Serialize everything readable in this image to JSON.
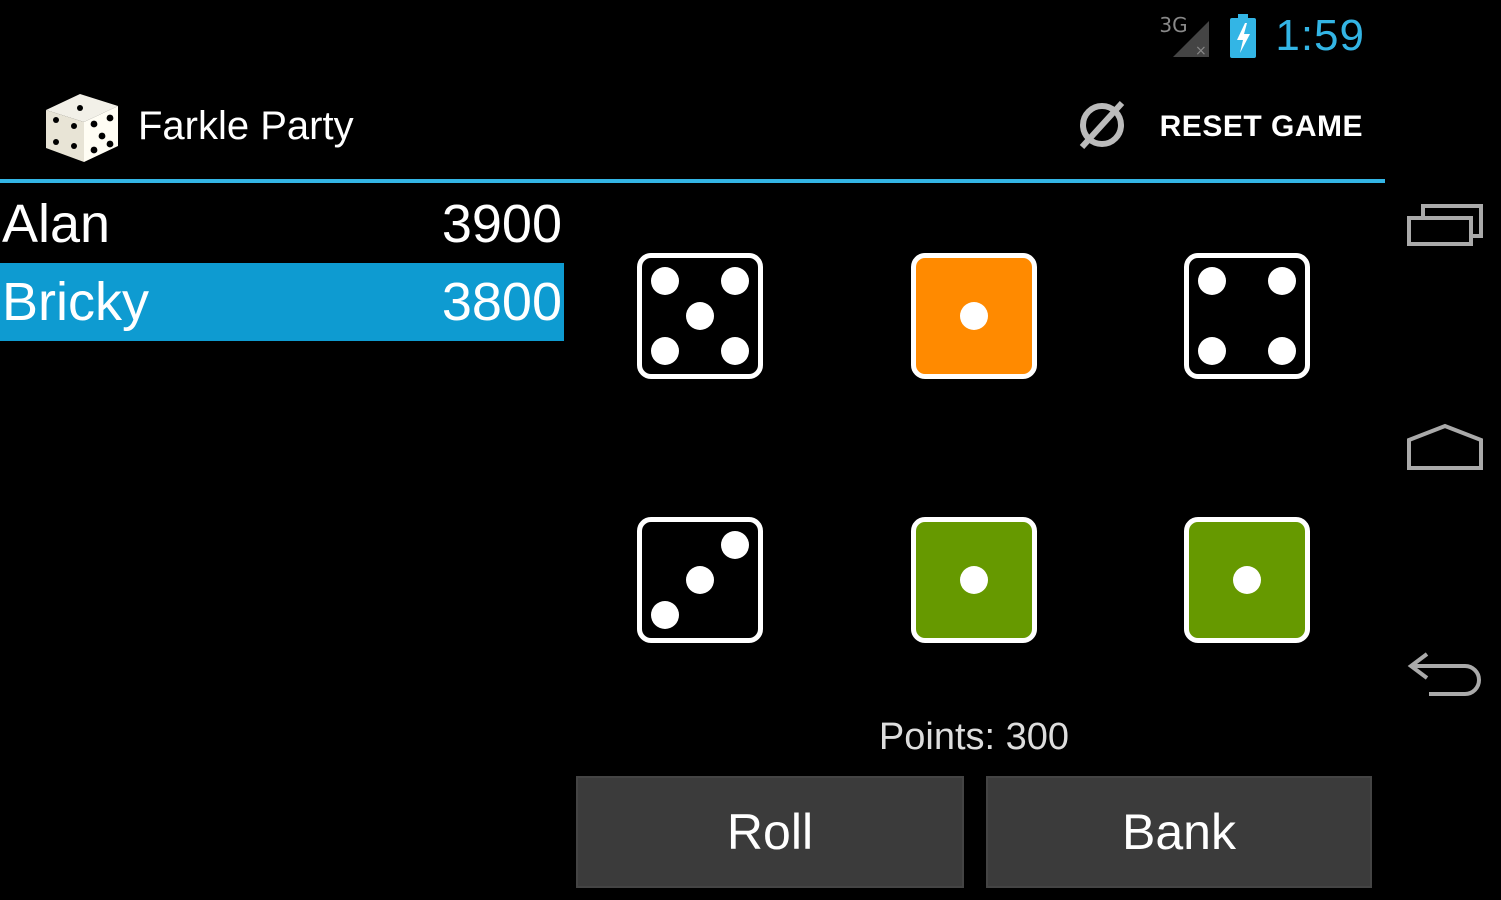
{
  "status": {
    "network": "3G",
    "time": "1:59"
  },
  "app": {
    "title": "Farkle Party",
    "reset_label": "RESET GAME"
  },
  "players": [
    {
      "name": "Alan",
      "score": "3900",
      "active": false
    },
    {
      "name": "Bricky",
      "score": "3800",
      "active": true
    }
  ],
  "dice": [
    {
      "face": 5,
      "state": "rolled"
    },
    {
      "face": 1,
      "state": "held-orange"
    },
    {
      "face": 4,
      "state": "rolled"
    },
    {
      "face": 3,
      "state": "rolled"
    },
    {
      "face": 1,
      "state": "held-green"
    },
    {
      "face": 1,
      "state": "held-green"
    }
  ],
  "points_label": "Points: 300",
  "buttons": {
    "roll": "Roll",
    "bank": "Bank"
  },
  "colors": {
    "accent": "#33b5e5",
    "active_row": "#0e9bd1",
    "held_orange": "#ff8a00",
    "held_green": "#669900",
    "button_bg": "#3b3b3b"
  },
  "icons": {
    "app": "dice-icon",
    "reset": "reset-icon",
    "recents": "recent-apps-icon",
    "home": "home-icon",
    "back": "back-icon"
  }
}
